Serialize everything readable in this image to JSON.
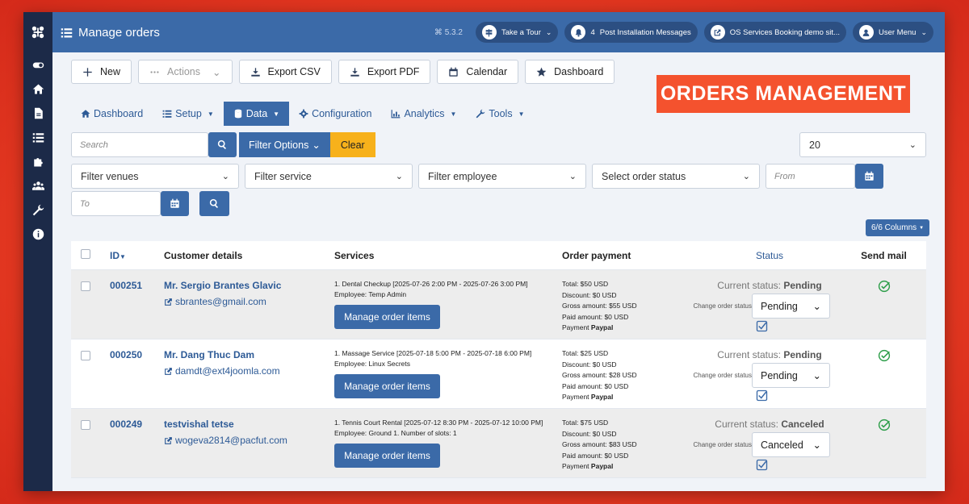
{
  "sidebar": {
    "logo": "joomla-logo",
    "items": [
      "toggle-icon",
      "home-icon",
      "file-icon",
      "list-icon",
      "puzzle-icon",
      "users-icon",
      "wrench-icon",
      "info-icon"
    ]
  },
  "topbar": {
    "title": "Manage orders",
    "version": "5.3.2",
    "pills": [
      {
        "label": "Take a Tour",
        "icon": "signpost-icon"
      },
      {
        "label": "Post Installation Messages",
        "icon": "bell-icon",
        "count": "4"
      },
      {
        "label": "OS Services Booking demo sit...",
        "icon": "external-icon"
      },
      {
        "label": "User Menu",
        "icon": "user-icon"
      }
    ]
  },
  "toolbar": {
    "new": "New",
    "actions": "Actions",
    "export_csv": "Export CSV",
    "export_pdf": "Export PDF",
    "calendar": "Calendar",
    "dashboard": "Dashboard"
  },
  "banner": "ORDERS MANAGEMENT",
  "subnav": {
    "dashboard": "Dashboard",
    "setup": "Setup",
    "data": "Data",
    "configuration": "Configuration",
    "analytics": "Analytics",
    "tools": "Tools"
  },
  "filters": {
    "search_placeholder": "Search",
    "filter_options": "Filter Options",
    "clear": "Clear",
    "limit": "20",
    "venues": "Filter venues",
    "service": "Filter service",
    "employee": "Filter employee",
    "order_status": "Select order status",
    "from_placeholder": "From",
    "to_placeholder": "To"
  },
  "columns_button": "6/6 Columns",
  "table": {
    "headers": {
      "id": "ID",
      "customer": "Customer details",
      "services": "Services",
      "payment": "Order payment",
      "status": "Status",
      "mail": "Send mail"
    },
    "rows": [
      {
        "id": "000251",
        "name": "Mr. Sergio Brantes Glavic",
        "email": "sbrantes@gmail.com",
        "service": "1. Dental Checkup [2025-07-26 2:00 PM - 2025-07-26 3:00 PM]",
        "employee": "Employee: Temp Admin",
        "manage": "Manage order items",
        "total": "Total: $50 USD",
        "discount": "Discount: $0 USD",
        "gross": "Gross amount: $55 USD",
        "paid": "Paid amount: $0 USD",
        "payment_label": "Payment",
        "payment_method": "Paypal",
        "current_label": "Current status:",
        "current": "Pending",
        "change_label": "Change order status",
        "select": "Pending"
      },
      {
        "id": "000250",
        "name": "Mr. Dang Thuc Dam",
        "email": "damdt@ext4joomla.com",
        "service": "1. Massage Service [2025-07-18 5:00 PM - 2025-07-18 6:00 PM]",
        "employee": "Employee: Linux Secrets",
        "manage": "Manage order items",
        "total": "Total: $25 USD",
        "discount": "Discount: $0 USD",
        "gross": "Gross amount: $28 USD",
        "paid": "Paid amount: $0 USD",
        "payment_label": "Payment",
        "payment_method": "Paypal",
        "current_label": "Current status:",
        "current": "Pending",
        "change_label": "Change order status",
        "select": "Pending"
      },
      {
        "id": "000249",
        "name": "testvishal tetse",
        "email": "wogeva2814@pacfut.com",
        "service": "1. Tennis Court Rental [2025-07-12 8:30 PM - 2025-07-12 10:00 PM] Employee: Ground 1. Number of slots: 1",
        "employee": "",
        "manage": "Manage order items",
        "total": "Total: $75 USD",
        "discount": "Discount: $0 USD",
        "gross": "Gross amount: $83 USD",
        "paid": "Paid amount: $0 USD",
        "payment_label": "Payment",
        "payment_method": "Paypal",
        "current_label": "Current status:",
        "current": "Canceled",
        "change_label": "Change order status",
        "select": "Canceled"
      }
    ]
  },
  "colors": {
    "primary": "#3b6aa8",
    "sidebar": "#1c2a48",
    "banner": "#f4522e",
    "clear": "#f7b11b",
    "check": "#2e9e4a"
  }
}
